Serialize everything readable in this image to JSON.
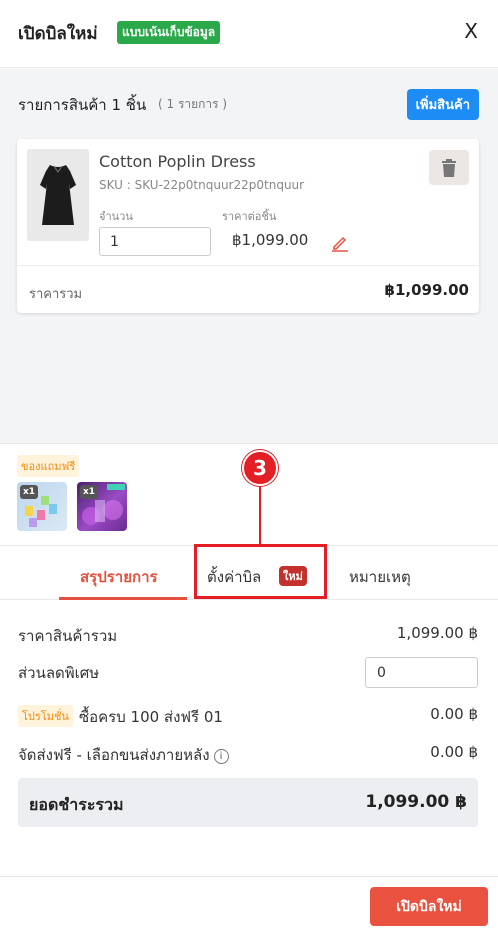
{
  "header": {
    "title": "เปิดบิลใหม่",
    "badge": "แบบเน้นเก็บข้อมูล",
    "close_label": "X"
  },
  "products": {
    "section_title": "รายการสินค้า 1 ชิ้น",
    "item_count": "( 1 รายการ )",
    "add_button": "เพิ่มสินค้า",
    "items": [
      {
        "name": "Cotton Poplin Dress",
        "sku": "SKU : SKU-22p0tnquur22p0tnquur",
        "qty_label": "จำนวน",
        "qty_value": "1",
        "price_label": "ราคาต่อชิ้น",
        "unit_price": "฿1,099.00",
        "total_label": "ราคารวม",
        "total_value": "฿1,099.00"
      }
    ]
  },
  "freebies": {
    "label": "ของแถมฟรี",
    "items": [
      {
        "qty": "x1",
        "icon": "gift-product-1"
      },
      {
        "qty": "x1",
        "icon": "gift-product-2"
      }
    ]
  },
  "callout": {
    "number": "3",
    "color": "#e31e24"
  },
  "tabs": {
    "summary": "สรุปรายการ",
    "settings": "ตั้งค่าบิล",
    "settings_badge": "ใหม่",
    "notes": "หมายเหตุ"
  },
  "summary": {
    "subtotal_label": "ราคาสินค้ารวม",
    "subtotal_value": "1,099.00 ฿",
    "discount_label": "ส่วนลดพิเศษ",
    "discount_value": "0",
    "promo_tag": "โปรโมชั่น",
    "promo_label": "ซื้อครบ 100 ส่งฟรี 01",
    "promo_value": "0.00 ฿",
    "shipping_label": "จัดส่งฟรี - เลือกขนส่งภายหลัง",
    "shipping_info_icon": "i",
    "shipping_value": "0.00 ฿",
    "grand_total_label": "ยอดชำระรวม",
    "grand_total_value": "1,099.00 ฿"
  },
  "footer": {
    "submit_button": "เปิดบิลใหม่"
  },
  "colors": {
    "accent": "#e4523f",
    "primary_blue": "#1e8cf5",
    "green_badge": "#2aa84a",
    "orange_tag": "#f28a0f"
  }
}
